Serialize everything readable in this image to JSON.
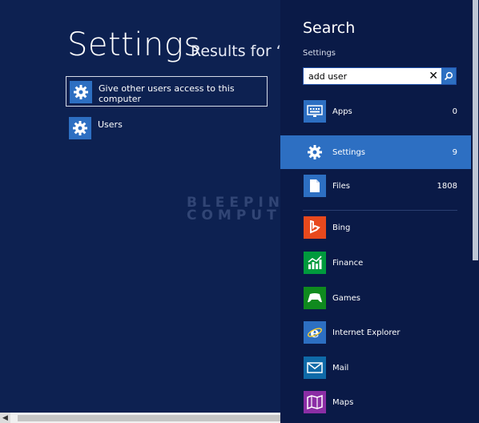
{
  "main": {
    "title": "Settings",
    "results_for": "Results for “ac",
    "results": [
      {
        "label": "Give other users access to this computer",
        "icon": "gear-icon"
      },
      {
        "label": "Users",
        "icon": "gear-icon"
      }
    ]
  },
  "watermark": {
    "line1": "BLEEPING",
    "line2": "COMPUTER"
  },
  "search": {
    "title": "Search",
    "scope": "Settings",
    "query": "add user",
    "scopes": [
      {
        "name": "Apps",
        "count": "0",
        "icon": "apps-icon",
        "selected": false
      },
      {
        "name": "Settings",
        "count": "9",
        "icon": "gear-icon",
        "selected": true
      },
      {
        "name": "Files",
        "count": "1808",
        "icon": "file-icon",
        "selected": false
      }
    ],
    "apps": [
      {
        "name": "Bing",
        "icon": "bing-icon",
        "color": "#e8491d"
      },
      {
        "name": "Finance",
        "icon": "finance-icon",
        "color": "#009a3d"
      },
      {
        "name": "Games",
        "icon": "games-icon",
        "color": "#0f8a1e"
      },
      {
        "name": "Internet Explorer",
        "icon": "internet-explorer-icon",
        "color": "#2d6fc2"
      },
      {
        "name": "Mail",
        "icon": "mail-icon",
        "color": "#0f6aa8"
      },
      {
        "name": "Maps",
        "icon": "maps-icon",
        "color": "#8b2ea5"
      }
    ]
  },
  "colors": {
    "background": "#0d2151",
    "charm": "#0a1a47",
    "accent": "#2d6fc2"
  }
}
